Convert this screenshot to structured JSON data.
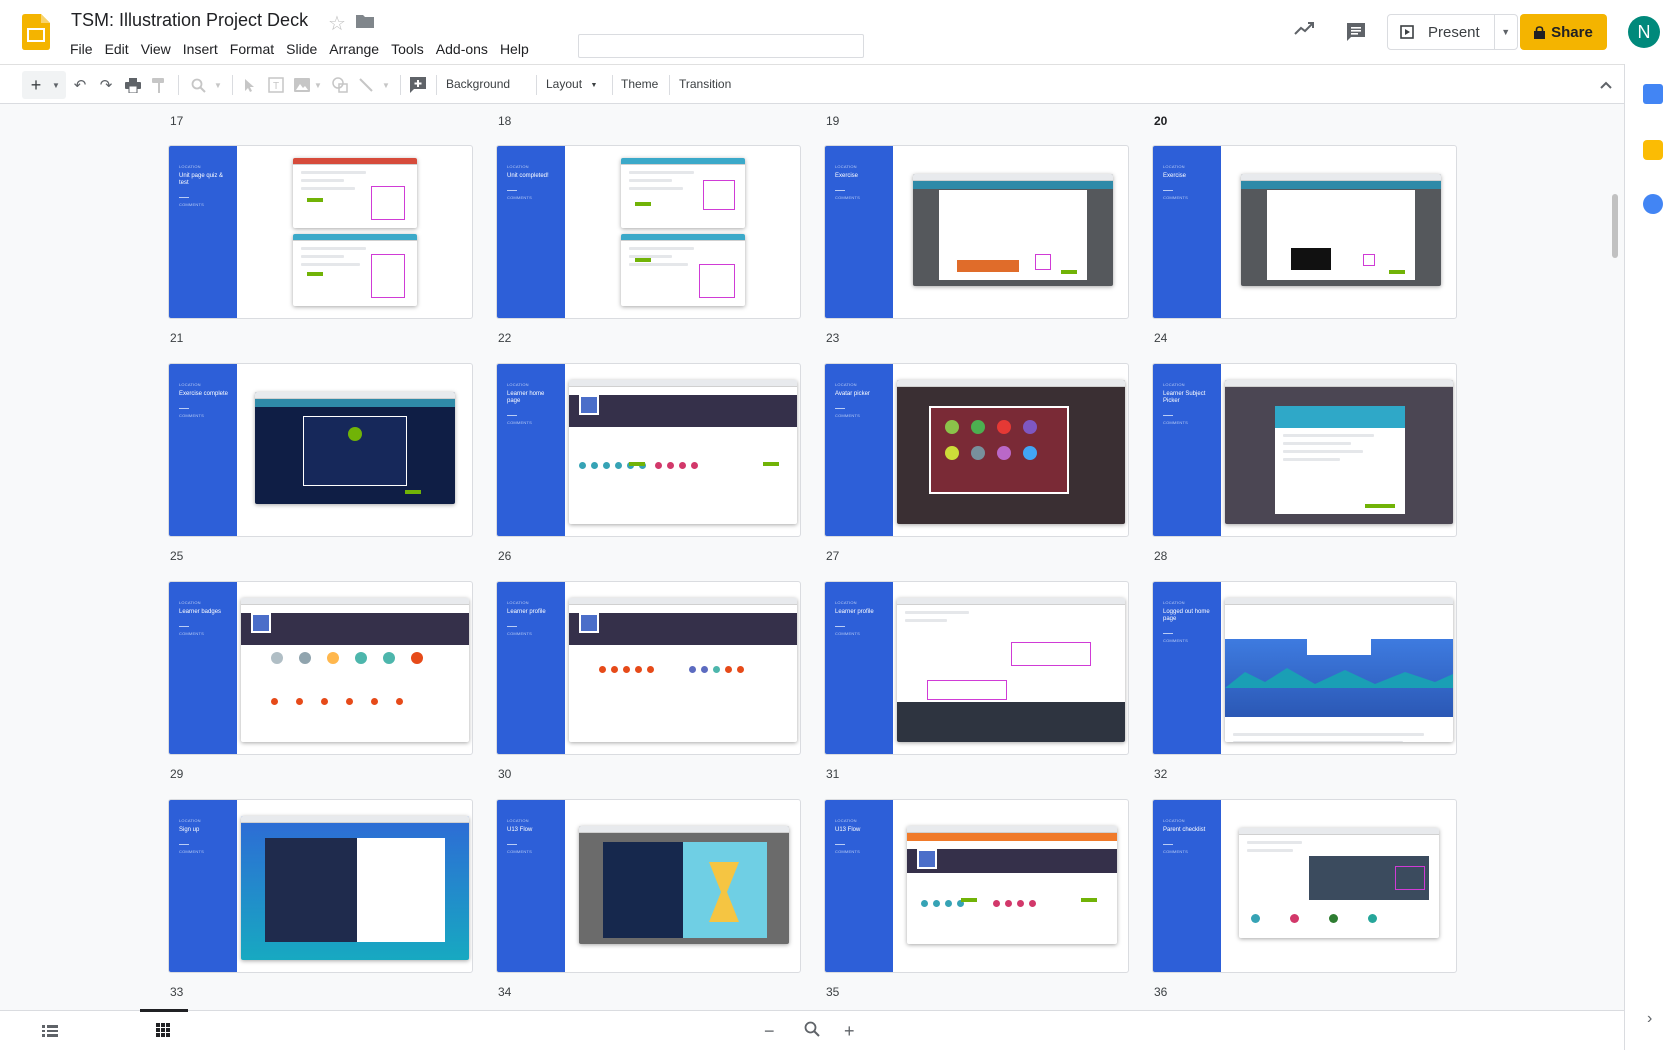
{
  "app": {
    "doc_title": "TSM: Illustration Project Deck",
    "menu": [
      "File",
      "Edit",
      "View",
      "Insert",
      "Format",
      "Slide",
      "Arrange",
      "Tools",
      "Add-ons",
      "Help"
    ],
    "present_label": "Present",
    "share_label": "Share",
    "avatar_letter": "N",
    "brand_color": "#f4b400"
  },
  "toolbar": {
    "background_label": "Background",
    "layout_label": "Layout",
    "theme_label": "Theme",
    "transition_label": "Transition"
  },
  "grid": {
    "top_numbers": [
      "17",
      "18",
      "19",
      "20"
    ],
    "rows": [
      {
        "slides": [
          {
            "number": "21",
            "title": "Unit page quiz & test"
          },
          {
            "number": "22",
            "title": "Unit completed!"
          },
          {
            "number": "23",
            "title": "Exercise"
          },
          {
            "number": "24",
            "title": "Exercise"
          }
        ]
      },
      {
        "slides": [
          {
            "number": "25",
            "title": "Exercise complete"
          },
          {
            "number": "26",
            "title": "Learner home page"
          },
          {
            "number": "27",
            "title": "Avatar picker"
          },
          {
            "number": "28",
            "title": "Learner Subject Picker"
          }
        ]
      },
      {
        "slides": [
          {
            "number": "29",
            "title": "Learner badges"
          },
          {
            "number": "30",
            "title": "Learner profile"
          },
          {
            "number": "31",
            "title": "Learner profile"
          },
          {
            "number": "32",
            "title": "Logged out home page"
          }
        ]
      },
      {
        "slides": [
          {
            "number": "33",
            "title": "Sign up"
          },
          {
            "number": "34",
            "title": "U13 Flow"
          },
          {
            "number": "35",
            "title": "U13 Flow"
          },
          {
            "number": "36",
            "title": "Parent checklist"
          }
        ]
      }
    ],
    "current_top": "20"
  }
}
